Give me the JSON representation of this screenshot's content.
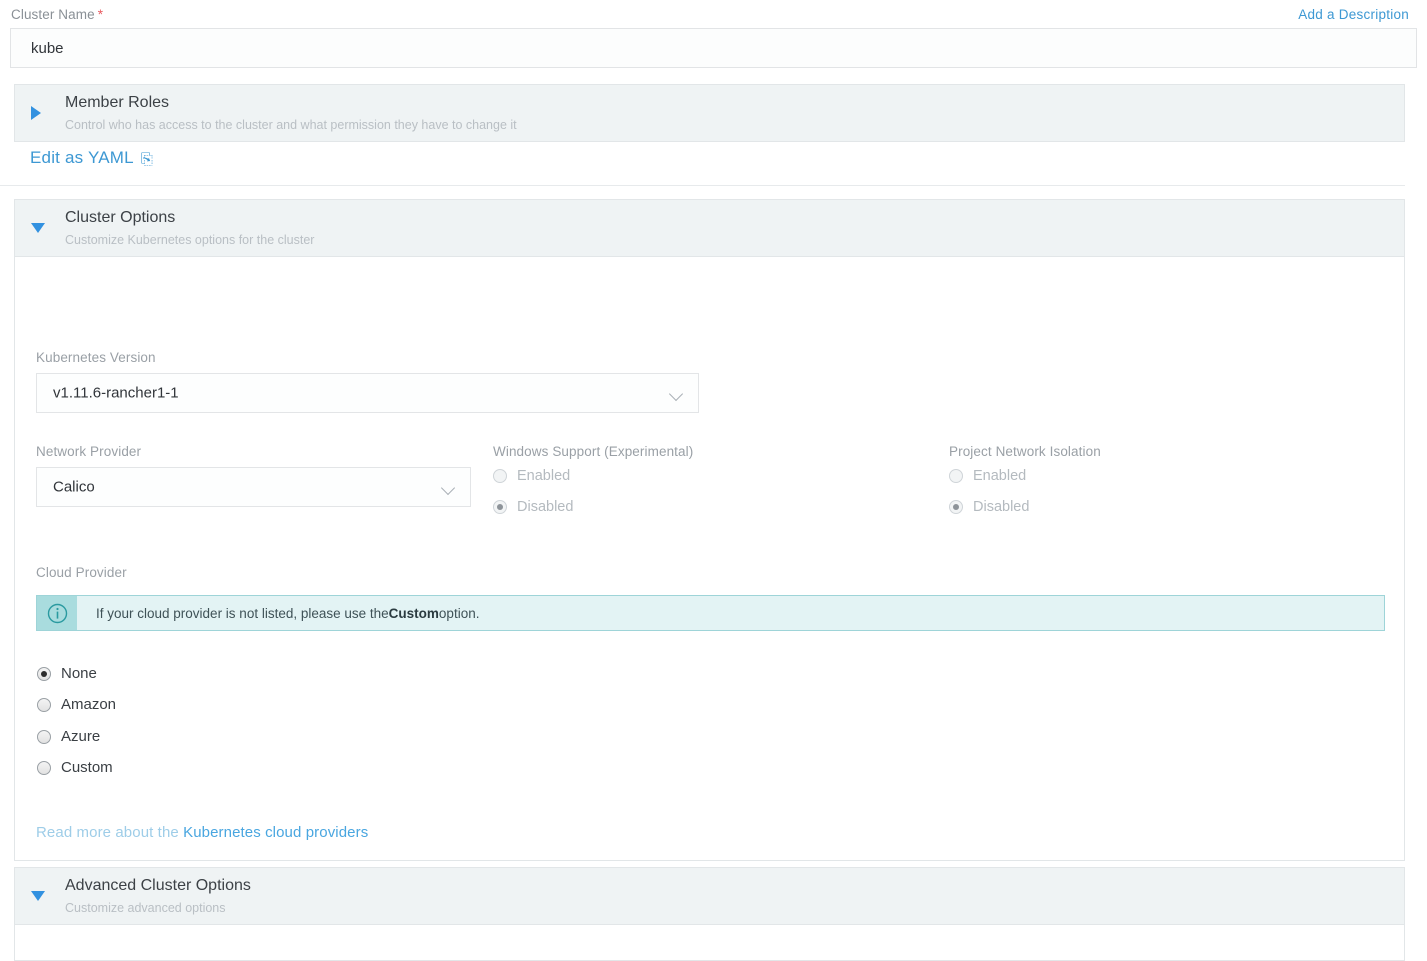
{
  "cluster_name": {
    "label": "Cluster Name",
    "required_marker": "*",
    "value": "kube",
    "add_description_link": "Add a Description"
  },
  "member_roles": {
    "title": "Member Roles",
    "subtitle": "Control who has access to the cluster and what permission they have to change it",
    "expanded": false
  },
  "yaml": {
    "link_label": "Edit as YAML",
    "icon": "clipboard-icon",
    "icon_glyph": "⎘"
  },
  "cluster_options": {
    "title": "Cluster Options",
    "subtitle": "Customize Kubernetes options for the cluster",
    "expanded": true,
    "kubernetes_version": {
      "label": "Kubernetes Version",
      "value": "v1.11.6-rancher1-1"
    },
    "network_provider": {
      "label": "Network Provider",
      "value": "Calico"
    },
    "windows_support": {
      "label": "Windows Support (Experimental)",
      "options": [
        "Enabled",
        "Disabled"
      ],
      "selected": "Disabled",
      "disabled": true
    },
    "project_network_isolation": {
      "label": "Project Network Isolation",
      "options": [
        "Enabled",
        "Disabled"
      ],
      "selected": "Disabled",
      "disabled": true
    },
    "cloud_provider": {
      "label": "Cloud Provider",
      "banner": {
        "icon": "info-icon",
        "text_before": "If your cloud provider is not listed, please use the ",
        "text_bold": "Custom",
        "text_after": " option."
      },
      "options": [
        "None",
        "Amazon",
        "Azure",
        "Custom"
      ],
      "selected": "None",
      "read_more_prefix": "Read more about the ",
      "read_more_link": "Kubernetes cloud providers"
    }
  },
  "advanced_cluster_options": {
    "title": "Advanced Cluster Options",
    "subtitle": "Customize advanced options",
    "expanded": true
  },
  "colors": {
    "link": "#3d98d3",
    "accent_triangle": "#3291e0",
    "panel_header_bg": "#eff3f4",
    "banner_bg": "#e3f3f4",
    "banner_border": "#9ed4d8",
    "required_star": "#e8595e"
  }
}
